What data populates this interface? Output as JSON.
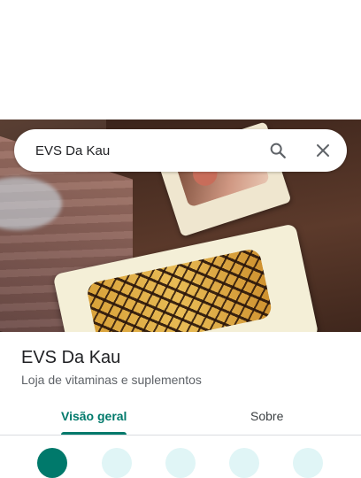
{
  "search": {
    "value": "EVS Da Kau",
    "search_icon": "search-icon",
    "close_icon": "close-icon"
  },
  "place": {
    "name": "EVS Da Kau",
    "category": "Loja de vitaminas e suplementos"
  },
  "tabs": [
    {
      "label": "Visão geral",
      "active": true
    },
    {
      "label": "Sobre",
      "active": false
    }
  ],
  "colors": {
    "accent": "#00796b",
    "secondary_action": "#e0f5f6",
    "text_primary": "#202124",
    "text_secondary": "#5f6368"
  }
}
